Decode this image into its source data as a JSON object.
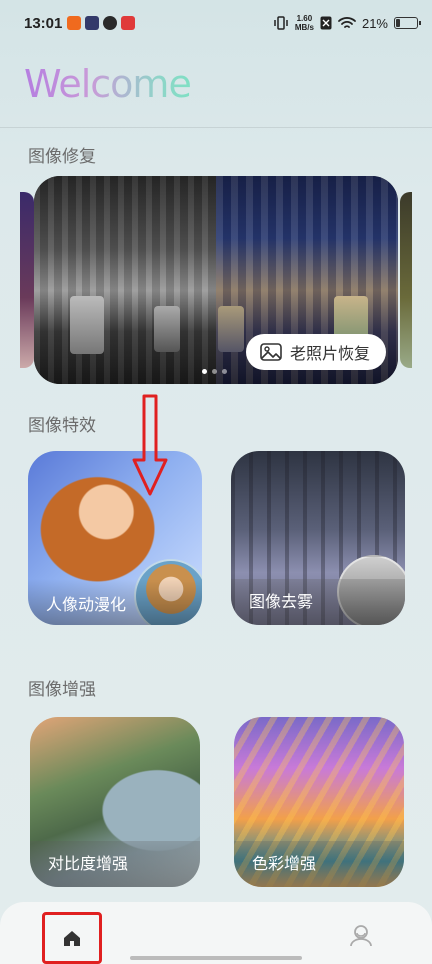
{
  "status_bar": {
    "time": "13:01",
    "net_speed_value": "1.60",
    "net_speed_unit": "MB/s",
    "battery_percent": "21%",
    "battery_level": 0.21
  },
  "header": {
    "title": "Welcome"
  },
  "sections": {
    "restore": {
      "title": "图像修复",
      "banner_button": "老照片恢复"
    },
    "effects": {
      "title": "图像特效",
      "cards": [
        {
          "label": "人像动漫化"
        },
        {
          "label": "图像去雾"
        }
      ]
    },
    "enhance": {
      "title": "图像增强",
      "cards": [
        {
          "label": "对比度增强"
        },
        {
          "label": "色彩增强"
        }
      ]
    }
  },
  "carousel": {
    "page_count": 3,
    "active_index": 0
  },
  "colors": {
    "annotation_red": "#e02020",
    "welcome_gradient_start": "#b57ee0",
    "welcome_gradient_end": "#7fe0c4"
  },
  "bottom_nav": {
    "items": [
      {
        "icon": "home-icon",
        "selected": true
      },
      {
        "icon": "profile-icon",
        "selected": false
      }
    ]
  }
}
